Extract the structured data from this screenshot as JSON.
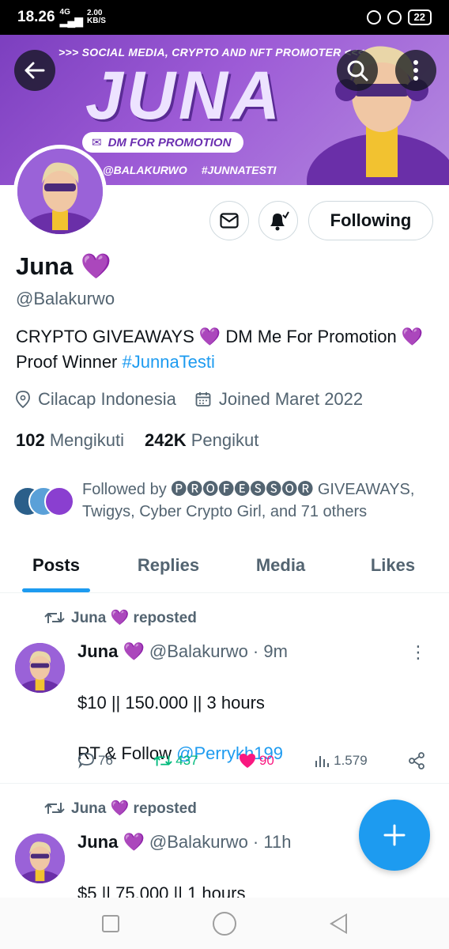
{
  "status_bar": {
    "time": "18.26",
    "network": "4G",
    "speed_value": "2.00",
    "speed_unit": "KB/S",
    "battery": "22"
  },
  "banner": {
    "tagline": ">>> SOCIAL MEDIA, CRYPTO AND NFT PROMOTER <<<",
    "title": "JUNA",
    "dm_text": "DM FOR PROMOTION",
    "social_handle": "@BALAKURWO",
    "social_tag": "#JUNNATESTI"
  },
  "profile": {
    "name": "Juna",
    "handle": "@Balakurwo",
    "bio_text": "CRYPTO GIVEAWAYS 💜 DM Me For Promotion 💜 Proof Winner ",
    "bio_link": "#JunnaTesti",
    "location": "Cilacap Indonesia",
    "joined": "Joined Maret 2022",
    "following_count": "102",
    "following_label": "Mengikuti",
    "followers_count": "242K",
    "followers_label": "Pengikut",
    "followed_by": "Followed by 🅟🅡🅞🅕🅔🅢🅢🅞🅡 GIVEAWAYS, Twigys, Cyber Crypto Girl, and 71 others",
    "follow_button": "Following"
  },
  "tabs": [
    "Posts",
    "Replies",
    "Media",
    "Likes"
  ],
  "posts": [
    {
      "repost_label": "Juna 💜 reposted",
      "name": "Juna 💜",
      "handle": "@Balakurwo",
      "time": "· 9m",
      "text_line1": "$10 || 150.000 || 3 hours",
      "text_line2_prefix": "RT & Follow ",
      "text_line2_link": "@Perrykh199",
      "replies": "76",
      "reposts": "437",
      "likes": "90",
      "views": "1.579"
    },
    {
      "repost_label": "Juna 💜 reposted",
      "name": "Juna 💜",
      "handle": "@Balakurwo",
      "time": "· 11h",
      "text_line1": "$5 || 75.000 || 1 hours"
    }
  ],
  "colors": {
    "accent": "#1d9bf0",
    "banner_purple": "#9d5bd6",
    "heart_purple": "#7b1fa2",
    "repost_green": "#00ba7c",
    "like_pink": "#f91880"
  }
}
